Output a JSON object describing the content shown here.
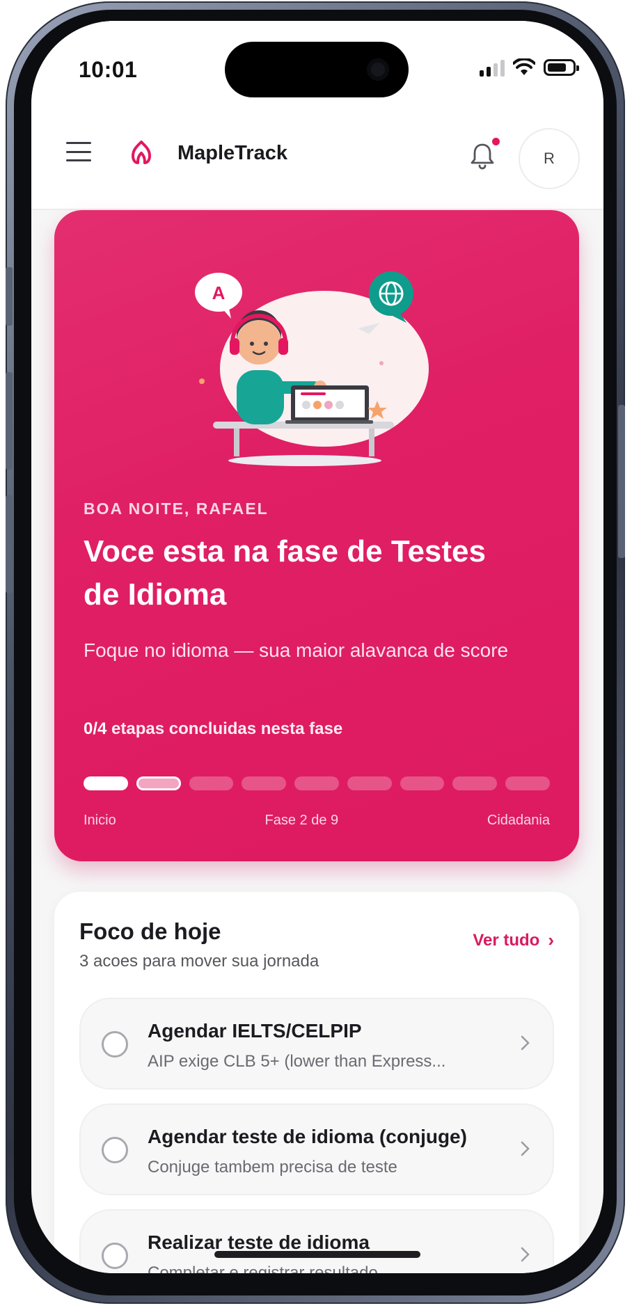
{
  "status_bar": {
    "time": "10:01"
  },
  "header": {
    "brand": "MapleTrack",
    "avatar_initial": "R",
    "has_notification": true
  },
  "hero": {
    "illustration_badge": "A",
    "greeting": "BOA NOITE, RAFAEL",
    "title": "Voce esta na fase de Testes de Idioma",
    "subtitle": "Foque no idioma — sua maior alavanca de score",
    "progress_count": "0/4",
    "progress_text": "etapas concluidas nesta fase",
    "phase": {
      "current": 2,
      "total": 9
    },
    "labels": {
      "start": "Inicio",
      "middle": "Fase 2 de 9",
      "end": "Cidadania"
    }
  },
  "focus": {
    "title": "Foco de hoje",
    "subtitle": "3 acoes para mover sua jornada",
    "see_all": "Ver tudo",
    "tasks": [
      {
        "title": "Agendar IELTS/CELPIP",
        "description": "AIP exige CLB 5+ (lower than Express...",
        "done": false
      },
      {
        "title": "Agendar teste de idioma (conjuge)",
        "description": "Conjuge tambem precisa de teste",
        "done": false
      },
      {
        "title": "Realizar teste de idioma",
        "description": "Completar e registrar resultado",
        "done": false
      }
    ]
  },
  "colors": {
    "accent": "#e01f64",
    "accent_text": "#d81b60",
    "background": "#f6f6f7"
  }
}
